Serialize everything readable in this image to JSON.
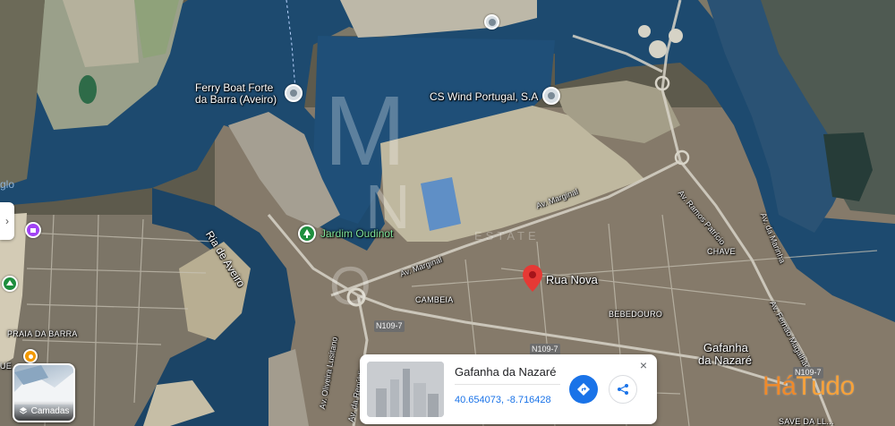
{
  "map": {
    "type": "satellite",
    "labels": {
      "ferry_line1": "Ferry Boat Forte",
      "ferry_line2": "da Barra (Aveiro)",
      "cs_wind": "CS Wind Portugal, S.A",
      "jardim": "Jardim Oudinot",
      "rua_nova": "Rua Nova",
      "ria": "Ria de Aveiro",
      "av_marginal_n": "Av. Marginal",
      "av_marginal_s": "Av. Marginal",
      "av_ramos": "Av. Ramos Patrício",
      "av_marinha": "Av. da Marinha",
      "av_fernao": "Av. Fernão Magalhães",
      "av_oliveira": "Av. Oliveira Lusitano",
      "av_republica": "Av. da República",
      "chave": "CHAVE",
      "cambeia": "CAMBEIA",
      "bebedouro": "BEBEDOURO",
      "praia_barra": "PRAIA DA BARRA",
      "gafanha_line1": "Gafanha",
      "gafanha_line2": "da Nazaré",
      "n109_a": "N109-7",
      "n109_b": "N109-7",
      "n109_c": "N109-7",
      "side_glo": "glo",
      "edge_ue": "UE",
      "bottom_right": "SAVE DA LL..."
    }
  },
  "controls": {
    "layers_label": "Camadas",
    "side_toggle": "›"
  },
  "place_card": {
    "title": "Gafanha da Nazaré",
    "coords": "40.654073, -8.716428",
    "close": "×"
  },
  "watermark": {
    "letter_m": "M",
    "letter_n": "N",
    "letter_o": "O",
    "word": "ESTATE"
  },
  "brand": {
    "part1": "Há",
    "part2": "Tudo"
  },
  "colors": {
    "water": "#1d4a6f",
    "accent_blue": "#1a73e8",
    "pin_red": "#e53935",
    "brand_orange": "#f08a2a"
  }
}
